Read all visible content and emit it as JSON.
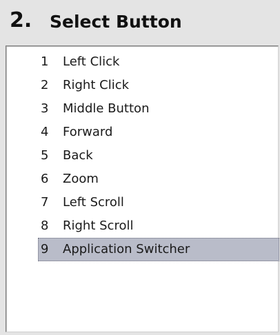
{
  "header": {
    "step": "2.",
    "title": "Select Button"
  },
  "button_list": {
    "items": [
      {
        "num": "1",
        "label": "Left Click"
      },
      {
        "num": "2",
        "label": "Right Click"
      },
      {
        "num": "3",
        "label": "Middle Button"
      },
      {
        "num": "4",
        "label": "Forward"
      },
      {
        "num": "5",
        "label": "Back"
      },
      {
        "num": "6",
        "label": "Zoom"
      },
      {
        "num": "7",
        "label": "Left Scroll"
      },
      {
        "num": "8",
        "label": "Right Scroll"
      },
      {
        "num": "9",
        "label": "Application Switcher"
      }
    ],
    "selected_item": "9"
  },
  "colors": {
    "background": "#e4e4e4",
    "list_background": "#ffffff",
    "selection": "#b9bcc9",
    "text": "#1a1a1a"
  }
}
